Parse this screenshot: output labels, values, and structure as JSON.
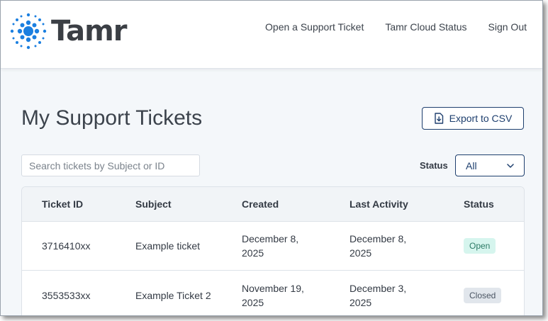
{
  "brand": {
    "name": "Tamr",
    "dot_color": "#1b7fe0"
  },
  "nav": {
    "items": [
      {
        "label": "Open a Support Ticket"
      },
      {
        "label": "Tamr Cloud Status"
      },
      {
        "label": "Sign Out"
      }
    ]
  },
  "page": {
    "title": "My Support Tickets",
    "export_label": "Export to CSV",
    "export_icon": "file-download-icon"
  },
  "filters": {
    "search_placeholder": "Search tickets by Subject or ID",
    "search_value": "",
    "status_label": "Status",
    "status_value": "All"
  },
  "table": {
    "columns": [
      "Ticket ID",
      "Subject",
      "Created",
      "Last Activity",
      "Status"
    ],
    "rows": [
      {
        "id": "3716410xx",
        "subject": "Example ticket",
        "created": [
          "December 8,",
          "2025"
        ],
        "last_activity": [
          "December 8,",
          "2025"
        ],
        "status": "Open"
      },
      {
        "id": "3553533xx",
        "subject": "Example Ticket 2",
        "created": [
          "November 19,",
          "2025"
        ],
        "last_activity": [
          "December 3,",
          "2025"
        ],
        "status": "Closed"
      }
    ]
  },
  "colors": {
    "accent": "#1e3f6e",
    "open_badge": "#d6f5ee",
    "closed_badge": "#e1e6ec"
  }
}
